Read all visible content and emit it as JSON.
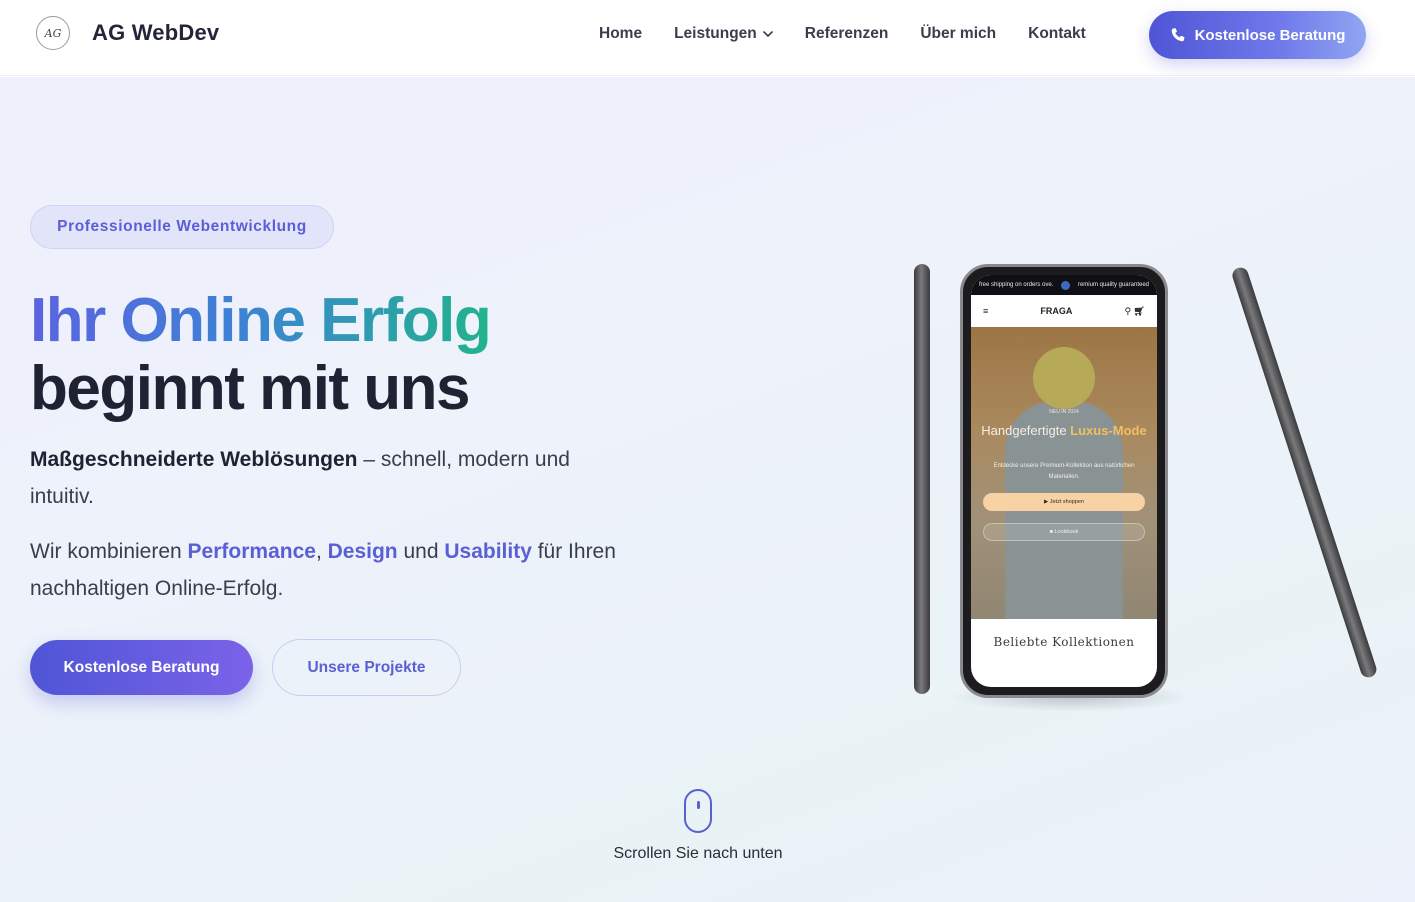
{
  "header": {
    "logo_text": "AG",
    "brand": "AG WebDev",
    "nav": [
      {
        "label": "Home"
      },
      {
        "label": "Leistungen"
      },
      {
        "label": "Referenzen"
      },
      {
        "label": "Über mich"
      },
      {
        "label": "Kontakt"
      }
    ],
    "cta_label": "Kostenlose Beratung",
    "cta_icon": "phone-icon"
  },
  "hero": {
    "badge": "Professionelle Webentwicklung",
    "headline_part1": "Ihr Online ",
    "headline_part2": "Erfolg",
    "headline_line2": "beginnt mit uns",
    "lead_strong": "Maßgeschneiderte Weblösungen",
    "lead_rest": " – schnell, modern und intuitiv.",
    "lead2_prefix": "Wir kombinieren ",
    "lead2_hl1": "Performance",
    "lead2_sep1": ", ",
    "lead2_hl2": "Design",
    "lead2_sep2": " und ",
    "lead2_hl3": "Usability",
    "lead2_suffix": " für Ihren nachhaltigen Online-Erfolg.",
    "primary_button": "Kostenlose Beratung",
    "secondary_button": "Unsere Projekte"
  },
  "phone_mockup": {
    "announcement_left": "free shipping on orders ove.",
    "announcement_right": "remium quality guaranteed",
    "shop_name": "FRAGA",
    "new_label": "NEU IN 2024",
    "title_plain": "Handgefertigte ",
    "title_gold": "Luxus-Mode",
    "description": "Entdecke unsere Premium-Kollektion aus natürlichen Materialien.",
    "button_primary": "▶ Jetzt shoppen",
    "button_secondary": "■ Lookbook",
    "collections": "Beliebte Kollektionen"
  },
  "scroll": {
    "text": "Scrollen Sie nach unten",
    "icon": "mouse-icon"
  },
  "colors": {
    "accent": "#5a5fd6",
    "accent_green": "#22b38c",
    "text_dark": "#1f2233"
  }
}
